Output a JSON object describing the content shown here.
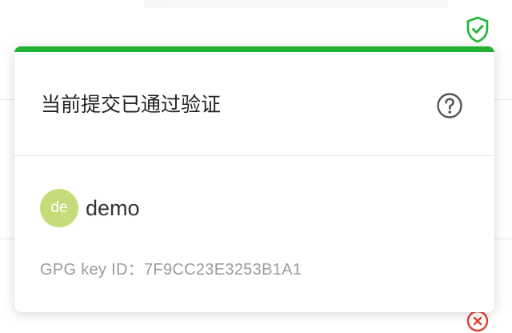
{
  "popover": {
    "title": "当前提交已通过验证",
    "accent_color": "#21b232",
    "help_icon": "question-circle-icon"
  },
  "status_icon": {
    "name": "shield-check-icon",
    "color": "#21b232"
  },
  "bottom_status_icon": {
    "name": "fail-circle-icon",
    "color": "#e03e2d"
  },
  "signer": {
    "avatar_initials": "de",
    "avatar_color": "#c5dc7a",
    "name": "demo"
  },
  "gpg": {
    "label": "GPG key ID：",
    "key_id": "7F9CC23E3253B1A1"
  }
}
